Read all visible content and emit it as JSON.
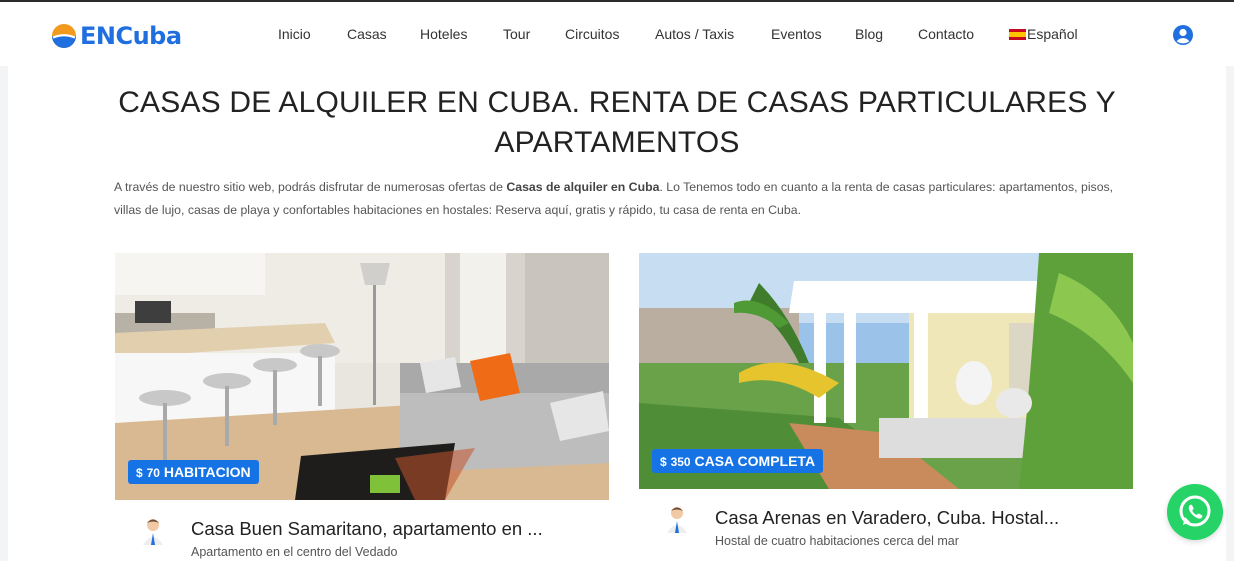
{
  "brand": {
    "name": "ENCuba"
  },
  "nav": {
    "items": [
      "Inicio",
      "Casas",
      "Hoteles",
      "Tour",
      "Circuitos",
      "Autos / Taxis",
      "Eventos",
      "Blog",
      "Contacto"
    ],
    "language": "Español"
  },
  "page": {
    "title_line1": "CASAS DE ALQUILER EN CUBA. RENTA DE CASAS PARTICULARES Y",
    "title_line2": "APARTAMENTOS",
    "intro_before": "A través de nuestro sitio web, podrás disfrutar de numerosas ofertas de ",
    "intro_bold": "Casas de alquiler en Cuba",
    "intro_after": ". Lo Tenemos todo en cuanto a la renta de casas particulares: apartamentos, pisos, villas de lujo, casas de playa y confortables habitaciones en hostales: Reserva aquí, gratis y rápido,  tu casa de renta en Cuba."
  },
  "listings": [
    {
      "currency": "$",
      "price": "70",
      "type": "HABITACION",
      "title": "Casa Buen Samaritano, apartamento en ...",
      "subtitle": "Apartamento en el centro del Vedado"
    },
    {
      "currency": "$",
      "price": "350",
      "type": "CASA COMPLETA",
      "title": "Casa Arenas en Varadero, Cuba. Hostal...",
      "subtitle": "Hostal de cuatro habitaciones cerca del mar"
    }
  ],
  "colors": {
    "brand_blue": "#1f6fe0",
    "badge_blue": "#1673e6",
    "whatsapp_green": "#25d366"
  }
}
